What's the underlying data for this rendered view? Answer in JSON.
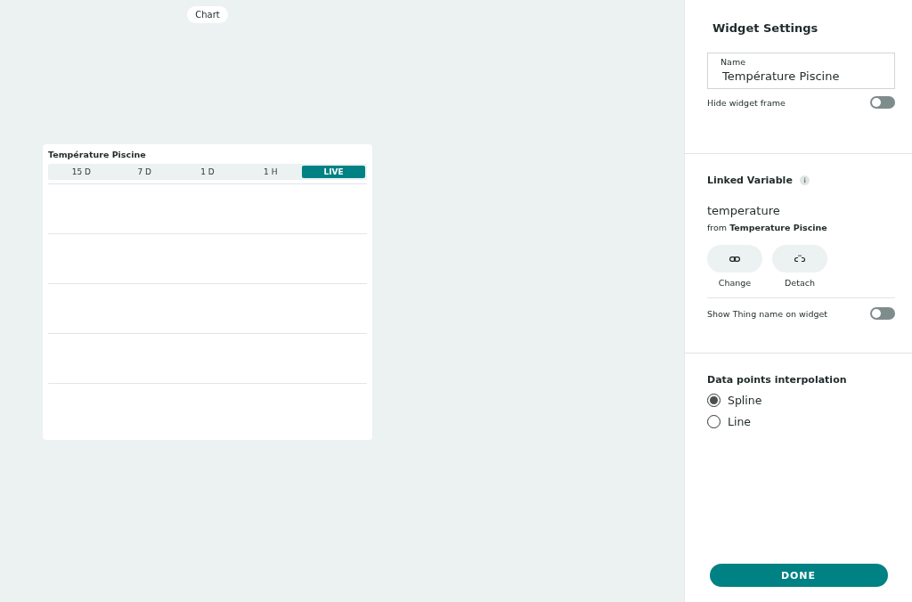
{
  "canvas": {
    "mode_label": "Chart",
    "widget": {
      "title": "Température Piscine",
      "ranges": [
        {
          "label": "15 D",
          "selected": false
        },
        {
          "label": "7 D",
          "selected": false
        },
        {
          "label": "1 D",
          "selected": false
        },
        {
          "label": "1 H",
          "selected": false
        },
        {
          "label": "LIVE",
          "selected": true
        }
      ]
    }
  },
  "settings": {
    "title": "Widget Settings",
    "name_field": {
      "label": "Name",
      "value": "Température Piscine"
    },
    "hide_frame": {
      "label": "Hide widget frame",
      "on": false
    },
    "linked_variable": {
      "heading": "Linked Variable",
      "variable": "temperature",
      "from_prefix": "from",
      "thing": "Temperature Piscine",
      "actions": [
        {
          "kind": "change",
          "label": "Change"
        },
        {
          "kind": "detach",
          "label": "Detach"
        }
      ],
      "show_thing": {
        "label": "Show Thing name on widget",
        "on": false
      }
    },
    "interpolation": {
      "heading": "Data points interpolation",
      "options": [
        {
          "label": "Spline",
          "selected": true
        },
        {
          "label": "Line",
          "selected": false
        }
      ]
    },
    "done_button": "DONE"
  }
}
